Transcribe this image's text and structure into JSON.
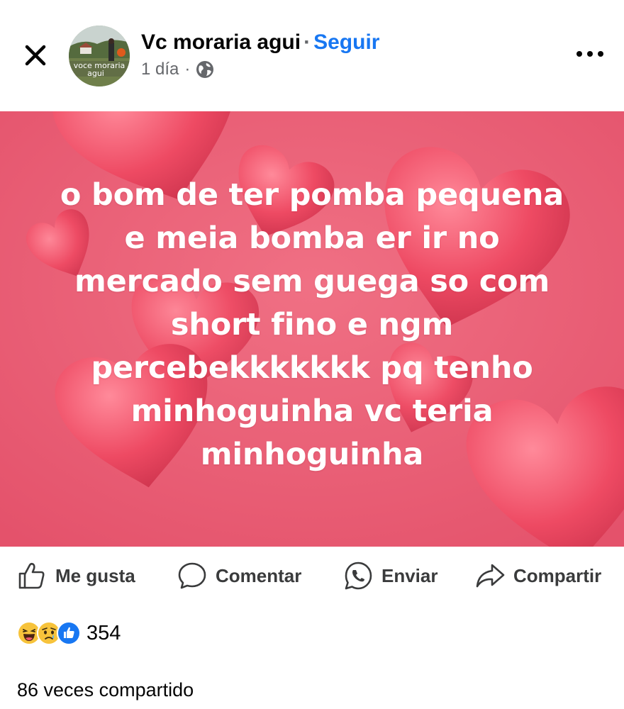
{
  "post": {
    "author": "Vc moraria agui",
    "separator": "·",
    "follow_label": "Seguir",
    "time": "1 día",
    "meta_dot": "·",
    "privacy_icon": "globe-icon",
    "avatar_caption_line1": "voce moraria",
    "avatar_caption_line2": "agui",
    "text": "o bom de ter pomba pequena\ne meia bomba er ir no\nmercado sem guega so com\nshort fino e ngm\npercebekkkkkkk pq tenho\nminhoguinha vc teria\nminhoguinha"
  },
  "actions": {
    "like": "Me gusta",
    "comment": "Comentar",
    "send": "Enviar",
    "share": "Compartir"
  },
  "reactions": {
    "icons": [
      "haha-icon",
      "sad-icon",
      "like-icon"
    ],
    "count": "354"
  },
  "shares": "86 veces compartido",
  "colors": {
    "follow": "#1877f2",
    "background_image": "#e9576d",
    "text_secondary": "#65676b"
  }
}
